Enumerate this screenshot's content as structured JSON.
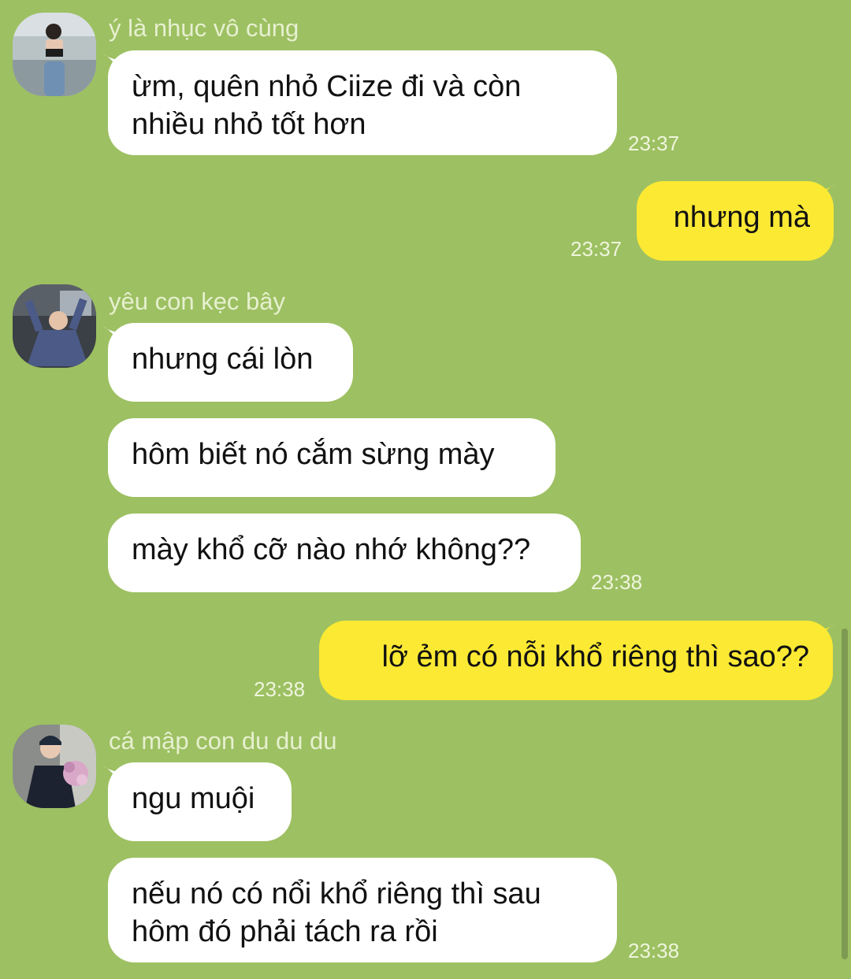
{
  "theme": {
    "background": "#9dc062",
    "incoming_bubble": "#ffffff",
    "outgoing_bubble": "#fbe934",
    "scrollbar": "#7e9a52"
  },
  "messages": [
    {
      "id": "g1",
      "direction": "incoming",
      "sender": "ý là nhục vô cùng",
      "avatar_icon": "user-avatar-photo",
      "bubbles": [
        {
          "lines": [
            "ừm, quên nhỏ Ciize đi và còn",
            "nhiều nhỏ tốt hơn"
          ],
          "time": "23:37"
        }
      ]
    },
    {
      "id": "o1",
      "direction": "outgoing",
      "bubbles": [
        {
          "lines": [
            "nhưng mà"
          ],
          "time": "23:37"
        }
      ]
    },
    {
      "id": "g2",
      "direction": "incoming",
      "sender": "yêu con kẹc bây",
      "avatar_icon": "user-avatar-photo",
      "bubbles": [
        {
          "lines": [
            "nhưng cái lòn"
          ],
          "time": ""
        },
        {
          "lines": [
            "hôm biết nó cắm sừng mày"
          ],
          "time": ""
        },
        {
          "lines": [
            "mày khổ cỡ nào nhớ không??"
          ],
          "time": "23:38"
        }
      ]
    },
    {
      "id": "o2",
      "direction": "outgoing",
      "bubbles": [
        {
          "lines": [
            "lỡ ẻm có nỗi khổ riêng thì sao??"
          ],
          "time": "23:38"
        }
      ]
    },
    {
      "id": "g3",
      "direction": "incoming",
      "sender": "cá mập con du du du",
      "avatar_icon": "user-avatar-photo",
      "bubbles": [
        {
          "lines": [
            "ngu muội"
          ],
          "time": ""
        },
        {
          "lines": [
            "nếu nó có nổi khổ riêng thì sau",
            "hôm đó phải tách ra rồi"
          ],
          "time": "23:38"
        }
      ]
    }
  ]
}
